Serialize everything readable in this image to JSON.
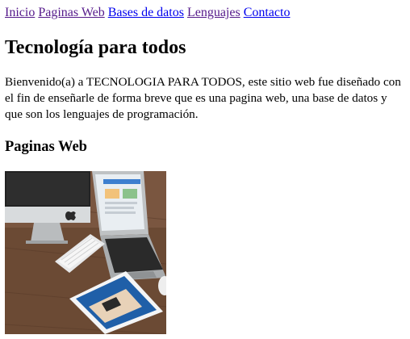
{
  "nav": {
    "links": [
      {
        "label": "Inicio",
        "state": "visited"
      },
      {
        "label": "Paginas Web",
        "state": "visited"
      },
      {
        "label": "Bases de datos",
        "state": "link"
      },
      {
        "label": "Lenguajes",
        "state": "visited"
      },
      {
        "label": "Contacto",
        "state": "link"
      }
    ]
  },
  "main": {
    "title": "Tecnología para todos",
    "intro": "Bienvenido(a) a TECNOLOGIA PARA TODOS, este sitio web fue diseñado con el fin de enseñarle de forma breve que es una pagina web, una base de datos y que son los lenguajes de programación.",
    "section_heading": "Paginas Web"
  },
  "image": {
    "subject": "desk-with-computer-laptop-tablet-keyboard"
  },
  "colors": {
    "link": "#0000ee",
    "visited": "#551a8b",
    "desk": "#6b4a34"
  }
}
